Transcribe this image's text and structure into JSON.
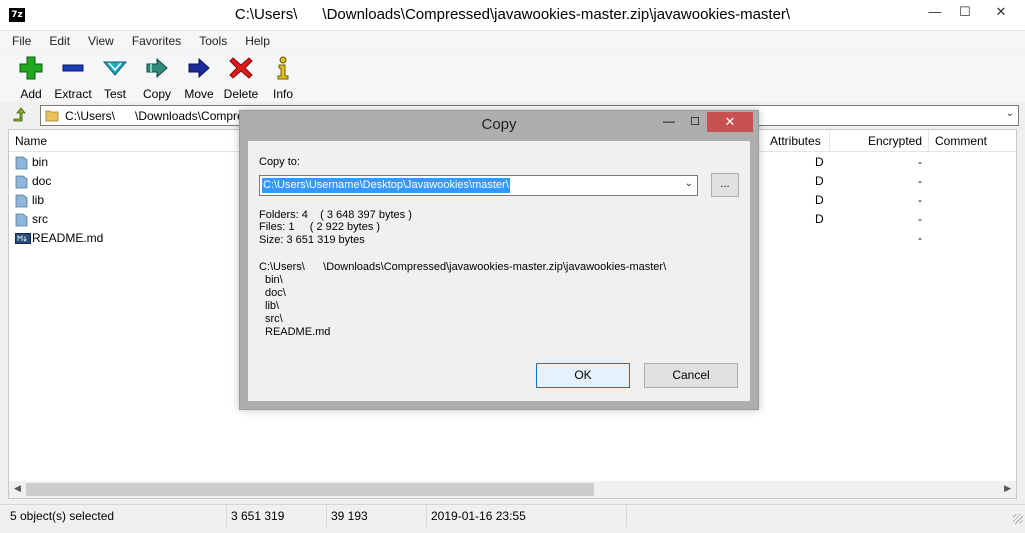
{
  "window": {
    "icon_text": "7z",
    "title": "C:\\Users\\      \\Downloads\\Compressed\\javawookies-master.zip\\javawookies-master\\",
    "minimize": "—",
    "maximize": "☐",
    "close": "✕"
  },
  "menu": [
    "File",
    "Edit",
    "View",
    "Favorites",
    "Tools",
    "Help"
  ],
  "toolbar": [
    {
      "label": "Add",
      "icon": "add-icon",
      "color": "#1fa81f"
    },
    {
      "label": "Extract",
      "icon": "extract-icon",
      "color": "#1a3bb8"
    },
    {
      "label": "Test",
      "icon": "test-icon",
      "color": "#16a9c0"
    },
    {
      "label": "Copy",
      "icon": "copy-icon",
      "color": "#2e8a7a"
    },
    {
      "label": "Move",
      "icon": "move-icon",
      "color": "#1a2a9a"
    },
    {
      "label": "Delete",
      "icon": "delete-icon",
      "color": "#e01b1b"
    },
    {
      "label": "Info",
      "icon": "info-icon",
      "color": "#e0c21b"
    }
  ],
  "address": {
    "path": "C:\\Users\\      \\Downloads\\Compre",
    "arrow": "⌄"
  },
  "columns": {
    "name": "Name",
    "attributes": "Attributes",
    "encrypted": "Encrypted",
    "comment": "Comment"
  },
  "files": [
    {
      "name": "bin",
      "type": "folder",
      "attributes": "D",
      "encrypted": "-"
    },
    {
      "name": "doc",
      "type": "folder",
      "attributes": "D",
      "encrypted": "-"
    },
    {
      "name": "lib",
      "type": "folder",
      "attributes": "D",
      "encrypted": "-"
    },
    {
      "name": "src",
      "type": "folder",
      "attributes": "D",
      "encrypted": "-"
    },
    {
      "name": "README.md",
      "type": "file",
      "attributes": "",
      "encrypted": "-"
    }
  ],
  "status": {
    "selected": "5 object(s) selected",
    "size": "3 651 319",
    "packed": "39 193",
    "modified": "2019-01-16 23:55"
  },
  "dialog": {
    "title": "Copy",
    "minimize": "—",
    "maximize": "☐",
    "close": "✕",
    "copy_to_label": "Copy to:",
    "destination": "C:\\Users\\Username\\Desktop\\Javawookies\\master\\",
    "browse": "...",
    "folders": "Folders: 4    ( 3 648 397 bytes )",
    "files": "Files: 1     ( 2 922 bytes )",
    "size": "Size: 3 651 319 bytes",
    "source_path": "C:\\Users\\      \\Downloads\\Compressed\\javawookies-master.zip\\javawookies-master\\",
    "items": [
      "bin\\",
      "doc\\",
      "lib\\",
      "src\\",
      "README.md"
    ],
    "ok": "OK",
    "cancel": "Cancel"
  }
}
